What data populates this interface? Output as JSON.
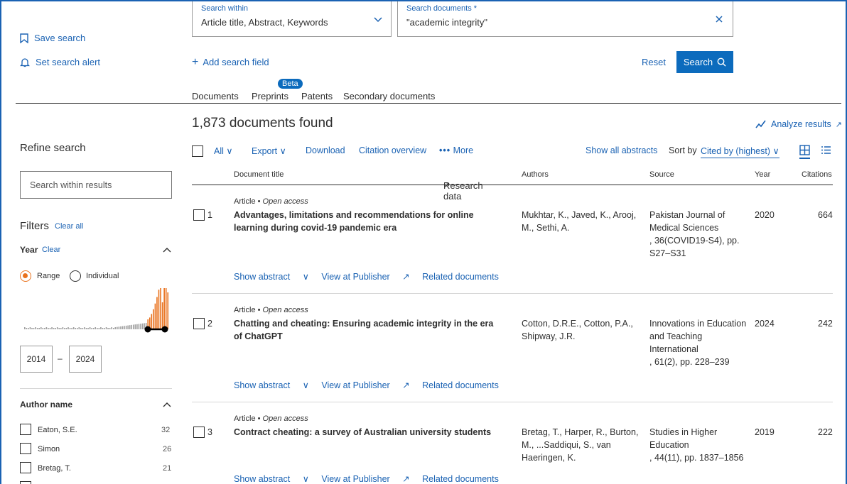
{
  "sidebar": {
    "save_search": "Save search",
    "set_alert": "Set search alert",
    "refine_title": "Refine search",
    "search_within_placeholder": "Search within results",
    "filters_title": "Filters",
    "clear_all": "Clear all",
    "year_title": "Year",
    "year_clear": "Clear",
    "range_label": "Range",
    "individual_label": "Individual",
    "year_from": "2014",
    "year_dash": "–",
    "year_to": "2024",
    "author_title": "Author name",
    "authors": [
      {
        "name": "Eaton, S.E.",
        "count": "32"
      },
      {
        "name": "Simon",
        "count": "26"
      },
      {
        "name": "Bretag, T.",
        "count": "21"
      }
    ]
  },
  "search": {
    "within_label": "Search within",
    "within_value": "Article title, Abstract, Keywords",
    "docs_label": "Search documents *",
    "docs_value": "\"academic integrity\"",
    "add_field": "Add search field",
    "reset": "Reset",
    "search_btn": "Search"
  },
  "tabs": {
    "beta": "Beta",
    "items": [
      "Documents",
      "Preprints",
      "Patents",
      "Secondary documents",
      "Research data"
    ]
  },
  "results": {
    "count_text": "1,873 documents found",
    "analyze": "Analyze results",
    "toolbar": {
      "all": "All",
      "export": "Export",
      "download": "Download",
      "citation_overview": "Citation overview",
      "more": "More",
      "show_all_abstracts": "Show all abstracts",
      "sort_by": "Sort by",
      "sort_value": "Cited by (highest)"
    },
    "columns": [
      "Document title",
      "Authors",
      "Source",
      "Year",
      "Citations"
    ],
    "rows": [
      {
        "num": "1",
        "type": "Article",
        "access": "Open access",
        "title": "Advantages, limitations and recommendations for online learning during covid-19 pandemic era",
        "authors": "Mukhtar, K., Javed, K., Arooj, M., Sethi, A.",
        "source_lines": [
          "Pakistan Journal of",
          "Medical Sciences",
          ", 36(COVID19-S4), pp.",
          "S27–S31"
        ],
        "year": "2020",
        "citations": "664"
      },
      {
        "num": "2",
        "type": "Article",
        "access": "Open access",
        "title": "Chatting and cheating: Ensuring academic integrity in the era of ChatGPT",
        "authors": "Cotton, D.R.E., Cotton, P.A., Shipway, J.R.",
        "source_lines": [
          "Innovations in Education",
          "and Teaching",
          "International",
          ", 61(2), pp. 228–239"
        ],
        "year": "2024",
        "citations": "242"
      },
      {
        "num": "3",
        "type": "Article",
        "access": "Open access",
        "title": "Contract cheating: a survey of Australian university students",
        "authors": "Bretag, T., Harper, R., Burton, M., ...Saddiqui, S., van Haeringen, K.",
        "source_lines": [
          "Studies in Higher",
          "Education",
          ", 44(11), pp. 1837–1856"
        ],
        "year": "2019",
        "citations": "222"
      }
    ],
    "row_actions": {
      "show_abstract": "Show abstract",
      "view_publisher": "View at Publisher",
      "related": "Related documents"
    }
  },
  "colors": {
    "accent": "#1a62b3",
    "button": "#0c6bbd",
    "orange": "#e9711c",
    "histogram_gray": "#a0a0a0"
  }
}
